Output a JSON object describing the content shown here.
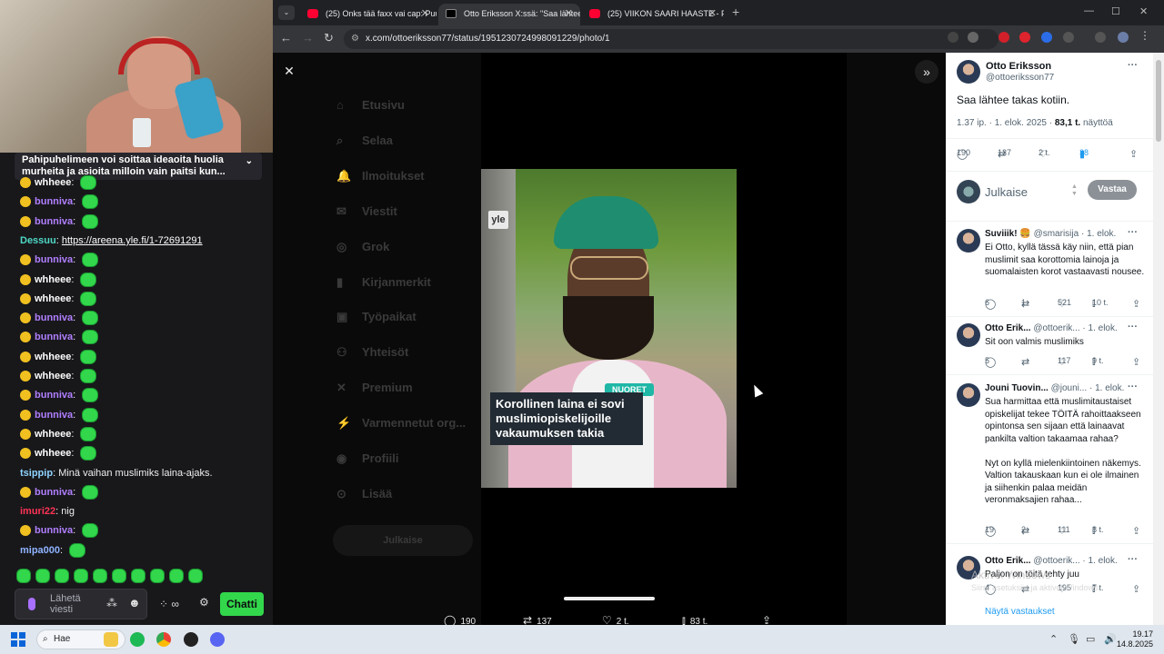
{
  "chat": {
    "pinned_text": "Pahipuhelimeen voi soittaa ideaoita huolia murheita ja asioita milloin vain paitsi kun...",
    "messages": [
      {
        "user": "whheee",
        "color": "#ffffff",
        "text": "",
        "badge": true,
        "emote": true
      },
      {
        "user": "bunniva",
        "color": "#b17fff",
        "text": "",
        "badge": true,
        "emote": true
      },
      {
        "user": "bunniva",
        "color": "#b17fff",
        "text": "",
        "badge": true,
        "emote": true
      },
      {
        "user": "Dessuu",
        "color": "#4fd9c6",
        "text": "",
        "link": "https://areena.yle.fi/1-72691291",
        "badge": false,
        "emote": false
      },
      {
        "user": "bunniva",
        "color": "#b17fff",
        "text": "",
        "badge": true,
        "emote": true
      },
      {
        "user": "whheee",
        "color": "#ffffff",
        "text": "",
        "badge": true,
        "emote": true
      },
      {
        "user": "whheee",
        "color": "#ffffff",
        "text": "",
        "badge": true,
        "emote": true
      },
      {
        "user": "bunniva",
        "color": "#b17fff",
        "text": "",
        "badge": true,
        "emote": true
      },
      {
        "user": "bunniva",
        "color": "#b17fff",
        "text": "",
        "badge": true,
        "emote": true
      },
      {
        "user": "whheee",
        "color": "#ffffff",
        "text": "",
        "badge": true,
        "emote": true
      },
      {
        "user": "whheee",
        "color": "#ffffff",
        "text": "",
        "badge": true,
        "emote": true
      },
      {
        "user": "bunniva",
        "color": "#b17fff",
        "text": "",
        "badge": true,
        "emote": true
      },
      {
        "user": "bunniva",
        "color": "#b17fff",
        "text": "",
        "badge": true,
        "emote": true
      },
      {
        "user": "whheee",
        "color": "#ffffff",
        "text": "",
        "badge": true,
        "emote": true
      },
      {
        "user": "whheee",
        "color": "#ffffff",
        "text": "",
        "badge": true,
        "emote": true
      },
      {
        "user": "tsippip",
        "color": "#8fd3ff",
        "text": "Minä vaihan muslimiks laina-ajaks.",
        "badge": false,
        "emote": false
      },
      {
        "user": "bunniva",
        "color": "#b17fff",
        "text": "",
        "badge": true,
        "emote": true
      },
      {
        "user": "imuri22",
        "color": "#ff3355",
        "text": "nig",
        "badge": false,
        "emote": false
      },
      {
        "user": "bunniva",
        "color": "#b17fff",
        "text": "",
        "badge": true,
        "emote": true
      },
      {
        "user": "mipa000",
        "color": "#8fb3ff",
        "text": "",
        "badge": false,
        "emote": true
      }
    ],
    "input_placeholder": "Lähetä viesti",
    "chat_button": "Chatti",
    "accent": "#32d74b"
  },
  "browser": {
    "tabs": [
      {
        "title": "(25) Onks tää faxx vai cap: Puu",
        "active": false
      },
      {
        "title": "Otto Eriksson X:ssä: \"Saa lähtee",
        "active": true
      },
      {
        "title": "(25) VIIKON SAARI HAASTE - P",
        "active": false
      }
    ],
    "url": "x.com/ottoeriksson77/status/1951230724998091229/photo/1"
  },
  "xnav": [
    "Etusivu",
    "Selaa",
    "Ilmoitukset",
    "Viestit",
    "Grok",
    "Kirjanmerkit",
    "Työpaikat",
    "Yhteisöt",
    "Premium",
    "Varmennetut org...",
    "Profiili",
    "Lisää"
  ],
  "xnav_post": "Julkaise",
  "photo": {
    "logo": "yle",
    "badge": "NUORET",
    "headline": "Korollinen laina ei sovi muslimiopiskelijoille vakaumuksen takia"
  },
  "viewer_stats": {
    "replies": "190",
    "reposts": "137",
    "likes": "2 t.",
    "views": "83 t."
  },
  "tweet": {
    "name": "Otto Eriksson",
    "handle": "@ottoeriksson77",
    "text": "Saa lähtee takas kotiin.",
    "meta_time": "1.37 ip. · 1. elok. 2025 · ",
    "meta_views": "83,1 t.",
    "meta_views_label": " näyttöä",
    "replies": "190",
    "reposts": "137",
    "likes": "2 t.",
    "bookmarks": "38"
  },
  "reply_placeholder": "Julkaise",
  "reply_button": "Vastaa",
  "replies": [
    {
      "name": "Suviiik! 🍔",
      "handle": "@smarisija",
      "date": "· 1. elok.",
      "text": "Ei Otto, kyllä tässä käy niin, että pian muslimit saa korottomia lainoja ja suomalaisten korot vastaavasti nousee.",
      "stats": [
        "6",
        "1",
        "521",
        "10 t."
      ]
    },
    {
      "name": "Otto Erik...",
      "handle": "@ottoerik...",
      "date": "· 1. elok.",
      "text": "Sit oon valmis muslimiks",
      "stats": [
        "5",
        "",
        "117",
        "9 t."
      ]
    },
    {
      "name": "Jouni Tuovin...",
      "handle": "@jouni...",
      "date": "· 1. elok.",
      "text": "Sua harmittaa että muslimitaustaiset opiskelijat tekee TÖITÄ rahoittaakseen opintonsa sen sijaan että lainaavat pankilta valtion takaamaa rahaa?\n\nNyt on kyllä mielenkiintoinen näkemys. Valtion takauskaan kun ei ole ilmainen ja siihenkin palaa meidän veronmaksajien rahaa...",
      "stats": [
        "19",
        "2",
        "111",
        "8 t."
      ]
    },
    {
      "name": "Otto Erik...",
      "handle": "@ottoerik...",
      "date": "· 1. elok.",
      "text": "Paljon on töitä tehty juu",
      "stats": [
        "4",
        "",
        "195",
        "7 t."
      ]
    }
  ],
  "show_replies": "Näytä vastaukset",
  "watermark": "Aktivoi Windows",
  "watermark_sub": "Siirry asetuksiin ja aktivoi Windows.",
  "taskbar": {
    "search": "Hae",
    "time": "19.17",
    "date": "14.8.2025"
  }
}
